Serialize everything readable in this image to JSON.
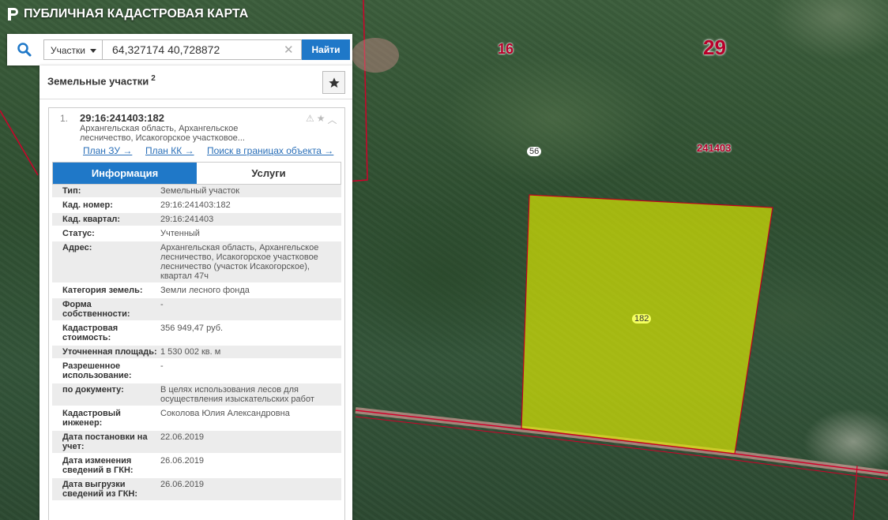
{
  "app": {
    "title": "ПУБЛИЧНАЯ КАДАСТРОВАЯ КАРТА"
  },
  "search": {
    "type_value": "Участки",
    "query_value": "64,327174 40,728872",
    "find_label": "Найти"
  },
  "panel": {
    "title": "Земельные участки",
    "count": "2"
  },
  "result": {
    "number": "1.",
    "cad_number": "29:16:241403:182",
    "address_short": "Архангельская область, Архангельское лесничество, Исакогорское участковое...",
    "links": {
      "plan_zu": "План ЗУ →",
      "plan_kk": "План КК →",
      "search_bounds": "Поиск в границах объекта →"
    },
    "tabs": {
      "info": "Информация",
      "services": "Услуги"
    },
    "fields": [
      {
        "key": "Тип:",
        "value": "Земельный участок"
      },
      {
        "key": "Кад. номер:",
        "value": "29:16:241403:182"
      },
      {
        "key": "Кад. квартал:",
        "value": "29:16:241403"
      },
      {
        "key": "Статус:",
        "value": "Учтенный"
      },
      {
        "key": "Адрес:",
        "value": "Архангельская область, Архангельское лесничество, Исакогорское участковое лесничество (участок Исакогорское), квартал 47ч"
      },
      {
        "key": "Категория земель:",
        "value": "Земли лесного фонда"
      },
      {
        "key": "Форма собственности:",
        "value": "-"
      },
      {
        "key": "Кадастровая стоимость:",
        "value": "356 949,47 руб."
      },
      {
        "key": "Уточненная площадь:",
        "value": "1 530 002 кв. м"
      },
      {
        "key": "Разрешенное использование:",
        "value": "-"
      },
      {
        "key": "по документу:",
        "value": "В целях использования лесов для осуществления изыскательских работ"
      },
      {
        "key": "Кадастровый инженер:",
        "value": "Соколова Юлия Александровна"
      },
      {
        "key": "Дата постановки на учет:",
        "value": "22.06.2019"
      },
      {
        "key": "Дата изменения сведений в ГКН:",
        "value": "26.06.2019"
      },
      {
        "key": "Дата выгрузки сведений из ГКН:",
        "value": "26.06.2019"
      }
    ]
  },
  "map": {
    "labels": {
      "district": "16",
      "region": "29",
      "quarter": "241403",
      "parcel_56": "56",
      "parcel_182": "182"
    }
  },
  "colors": {
    "accent": "#1f78c8",
    "parcel_fill": "#e3f000",
    "boundary": "#c00020"
  }
}
